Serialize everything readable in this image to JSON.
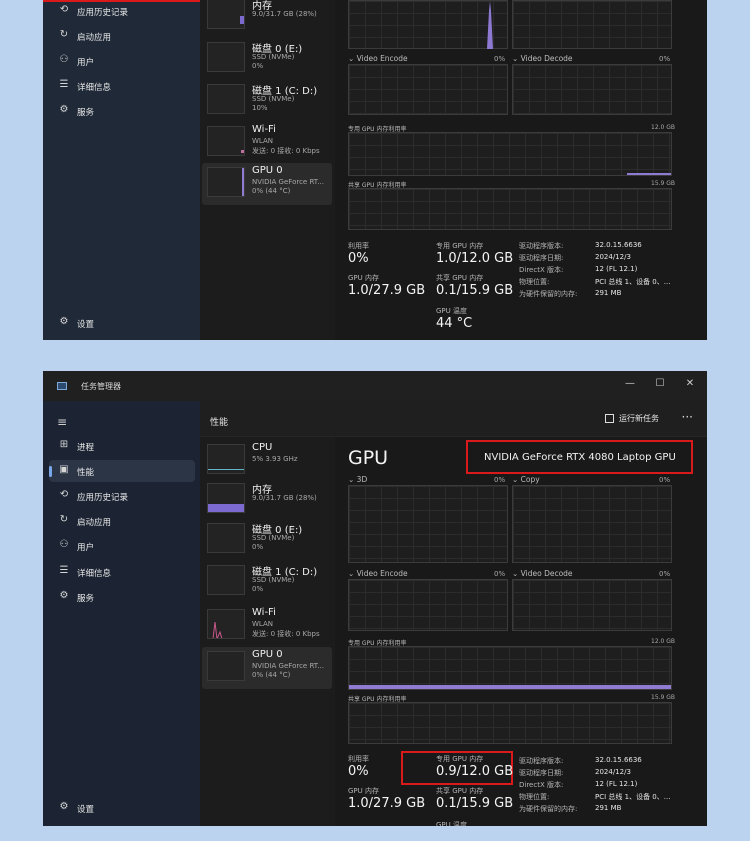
{
  "window": {
    "title": "任务管理器",
    "minimize": "—",
    "maximize": "☐",
    "close": "✕"
  },
  "header": {
    "title": "性能",
    "run_task": "运行新任务",
    "more": "···"
  },
  "nav": {
    "processes": "进程",
    "performance": "性能",
    "app_history": "应用历史记录",
    "startup": "启动应用",
    "users": "用户",
    "details": "详细信息",
    "services": "服务",
    "settings": "设置"
  },
  "devices": {
    "cpu": {
      "name": "CPU",
      "sub1": "5%  3.93 GHz"
    },
    "memory": {
      "name": "内存",
      "sub1": "9.0/31.7 GB (28%)"
    },
    "disk0": {
      "name": "磁盘 0 (E:)",
      "sub1": "SSD (NVMe)",
      "sub2": "0%"
    },
    "disk1": {
      "name": "磁盘 1 (C: D:)",
      "sub1": "SSD (NVMe)",
      "sub2_top": "10%",
      "sub2_bottom": "0%"
    },
    "wifi": {
      "name": "Wi-Fi",
      "sub1": "WLAN",
      "sub2": "发送: 0  接收: 0 Kbps"
    },
    "gpu": {
      "name": "GPU 0",
      "sub1": "NVIDIA GeForce RT...",
      "sub2": "0%  (44 °C)"
    }
  },
  "gpu": {
    "title": "GPU",
    "model": "NVIDIA GeForce RTX 4080 Laptop GPU",
    "engines": {
      "e3d": "3D",
      "copy": "Copy",
      "video_encode": "Video Encode",
      "video_decode": "Video Decode",
      "pct_3d": "0%",
      "pct_copy": "0%",
      "pct_encode": "0%",
      "pct_decode": "0%"
    },
    "dedicated_usage": {
      "label": "专用 GPU 内存利用率",
      "max": "12.0 GB"
    },
    "shared_usage": {
      "label": "共享 GPU 内存利用率",
      "max": "15.9 GB"
    },
    "stats": {
      "util_label": "利用率",
      "util": "0%",
      "dedicated_label": "专用 GPU 内存",
      "dedicated_top": "1.0/12.0 GB",
      "dedicated_bottom": "0.9/12.0 GB",
      "gpu_mem_label": "GPU 内存",
      "gpu_mem": "1.0/27.9 GB",
      "shared_label": "共享 GPU 内存",
      "shared": "0.1/15.9 GB",
      "temp_label": "GPU 温度",
      "temp": "44 °C"
    },
    "info": {
      "driver_version_k": "驱动程序版本:",
      "driver_version": "32.0.15.6636",
      "driver_date_k": "驱动程序日期:",
      "driver_date": "2024/12/3",
      "directx_k": "DirectX 版本:",
      "directx": "12 (FL 12.1)",
      "location_k": "物理位置:",
      "location": "PCI 总线 1、设备 0、...",
      "reserved_k": "为硬件保留的内存:",
      "reserved": "291 MB"
    }
  },
  "colors": {
    "accent": "#7aa7e8",
    "gpu_graph": "#9a86d6",
    "highlight": "#d81a1a"
  }
}
